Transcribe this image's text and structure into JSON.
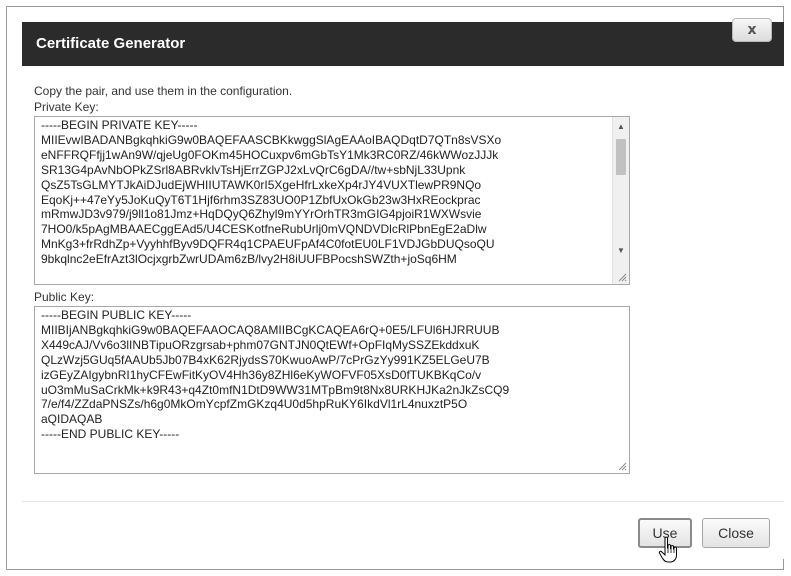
{
  "dialog": {
    "title": "Certificate Generator",
    "close_glyph": "x",
    "instruction": "Copy the pair, and use them in the configuration.",
    "private_key_label": "Private Key:",
    "public_key_label": "Public Key:",
    "private_key_value": "-----BEGIN PRIVATE KEY-----\nMIIEvwIBADANBgkqhkiG9w0BAQEFAASCBKkwggSlAgEAAoIBAQDqtD7QTn8sVSXo\neNFFRQFfjj1wAn9W/qjeUg0FOKm45HOCuxpv6mGbTsY1Mk3RC0RZ/46kWWozJJJk\nSR13G4pAvNbOPkZSrl8ABRvklvTsHjErrZGPJ2xLvQrC6gDA//tw+sbNjL33Upnk\nQsZ5TsGLMYTJkAiDJudEjWHIIUTAWK0rI5XgeHfrLxkeXp4rJY4VUXTlewPR9NQo\nEqoKj++47eYy5JoKuQyT6T1Hjf6rhm3SZ83UO0P1ZbfUxOkGb23w3HxREockprac\nmRmwJD3v979/j9ll1o81Jmz+HqDQyQ6Zhyl9mYYrOrhTR3mGIG4pjoiR1WXWsvie\n7HO0/k5pAgMBAAECggEAd5/U4CESKotfneRubUrlj0mVQNDVDlcRlPbnEgE2aDlw\nMnKg3+frRdhZp+VyyhhfByv9DQFR4q1CPAEUFpAf4C0fotEU0LF1VDJGbDUQsoQU\n9bkqlnc2eEfrAzt3lOcjxgrbZwrUDAm6zB/lvy2H8iUUFBPocshSWZth+joSq6HM",
    "public_key_value": "-----BEGIN PUBLIC KEY-----\nMIIBIjANBgkqhkiG9w0BAQEFAAOCAQ8AMIIBCgKCAQEA6rQ+0E5/LFUl6HJRRUUB\nX449cAJ/Vv6o3lINBTipuORzgrsab+phm07GNTJN0QtEWf+OpFIqMySSZEkddxuK\nQLzWzj5GUq5fAAUb5Jb07B4xK62RjydsS70KwuoAwP/7cPrGzYy991KZ5ELGeU7B\nizGEyZAIgybnRI1hyCFEwFitKyOV4Hh36y8ZHl6eKyWOFVF05XsD0fTUKBKqCo/v\nuO3mMuSaCrkMk+k9R43+q4Zt0mfN1DtD9WW31MTpBm9t8Nx8URKHJKa2nJkZsCQ9\n7/e/f4/ZZdaPNSZs/h6g0MkOmYcpfZmGKzq4U0d5hpRuKY6IkdVl1rL4nuxztP5O\naQIDAQAB\n-----END PUBLIC KEY-----",
    "use_label": "Use",
    "close_label": "Close"
  },
  "icons": {
    "scroll_up": "scroll-up-arrow-icon",
    "scroll_down": "scroll-down-arrow-icon",
    "resize": "resize-grip-icon",
    "cursor": "hand-pointer-icon"
  },
  "colors": {
    "titlebar_bg": "#2b2b2b",
    "title_text": "#ffffff"
  }
}
